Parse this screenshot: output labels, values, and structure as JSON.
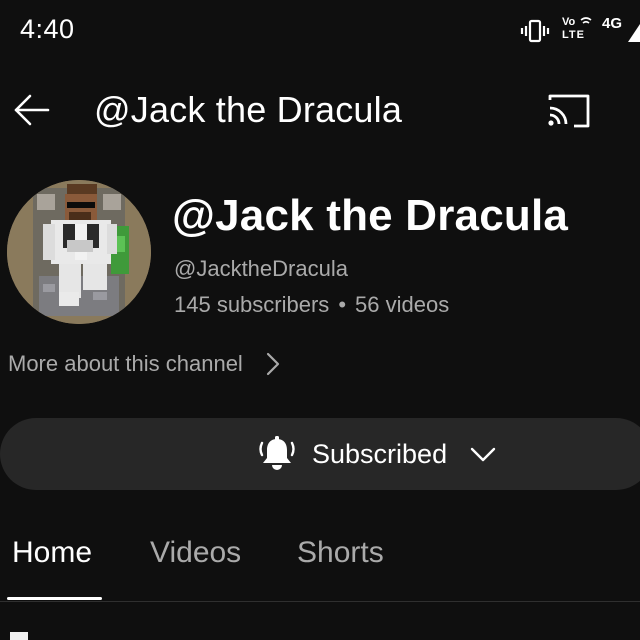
{
  "status_bar": {
    "time": "4:40",
    "volte_top": "Vo",
    "volte_bottom": "LTE",
    "network": "4G",
    "icons": [
      "vibrate-icon",
      "volte-icon",
      "signal-icon"
    ]
  },
  "top_bar": {
    "title": "@Jack the Dracula",
    "icons": [
      "back-arrow-icon",
      "cast-icon"
    ]
  },
  "channel": {
    "name": "@Jack the Dracula",
    "handle": "@JacktheDracula",
    "subscribers": "145 subscribers",
    "separator": "•",
    "videos": "56 videos",
    "more_about": "More about this channel"
  },
  "subscribe": {
    "label": "Subscribed",
    "icons": [
      "bell-icon",
      "chevron-down-icon"
    ]
  },
  "tabs": [
    {
      "label": "Home",
      "active": true
    },
    {
      "label": "Videos",
      "active": false
    },
    {
      "label": "Shorts",
      "active": false
    }
  ],
  "colors": {
    "background": "#0f0f0f",
    "text_primary": "#ffffff",
    "text_secondary": "#aaaaaa",
    "subscribe_bar": "#272727"
  }
}
